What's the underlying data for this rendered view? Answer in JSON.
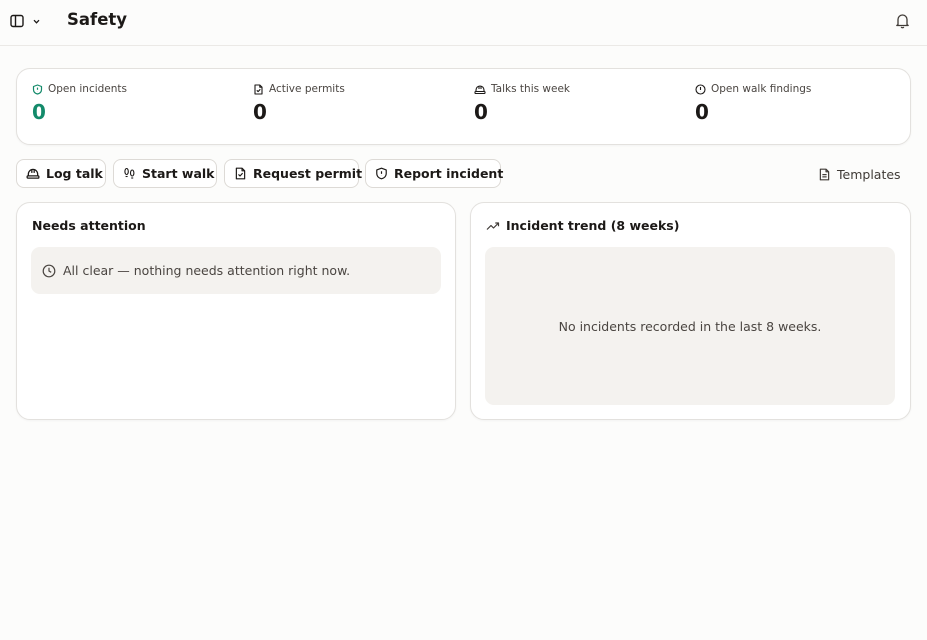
{
  "header": {
    "title": "Safety",
    "icons": {
      "sidebar": "sidebar-panel-icon",
      "chevron": "chevron-down-icon",
      "notifications": "bell-icon"
    }
  },
  "stats": [
    {
      "label": "Open incidents",
      "value": "0",
      "icon": "shield-icon",
      "value_color": "#138a6a"
    },
    {
      "label": "Active permits",
      "value": "0",
      "icon": "file-check-icon",
      "value_color": "#1c1917"
    },
    {
      "label": "Talks this week",
      "value": "0",
      "icon": "hard-hat-icon",
      "value_color": "#1c1917"
    },
    {
      "label": "Open walk findings",
      "value": "0",
      "icon": "alert-circle-icon",
      "value_color": "#1c1917"
    }
  ],
  "actions": {
    "log_talk": "Log talk",
    "start_walk": "Start walk",
    "request_permit": "Request permit",
    "report_incident": "Report incident",
    "templates": "Templates"
  },
  "needs_attention": {
    "title": "Needs attention",
    "empty_message": "All clear — nothing needs attention right now."
  },
  "incident_trend": {
    "title": "Incident trend (8 weeks)",
    "empty_message": "No incidents recorded in the last 8 weeks."
  },
  "colors": {
    "accent_green": "#138a6a",
    "text": "#1c1917",
    "muted_bg": "#f4f2ef",
    "border": "#e3e1de"
  }
}
